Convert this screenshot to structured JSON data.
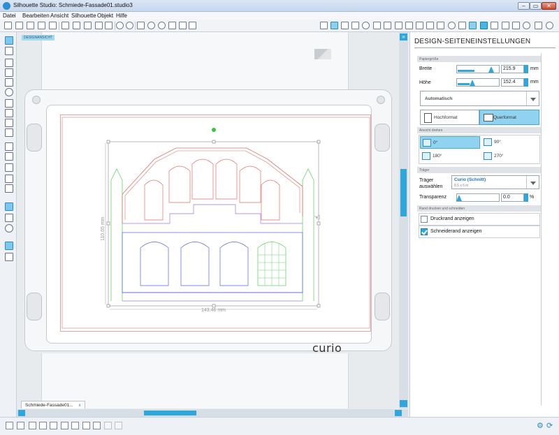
{
  "window": {
    "title": "Silhouette Studio: Schmiede-Fassade01.studio3",
    "min_glyph": "–",
    "max_glyph": "▭",
    "close_glyph": "✕"
  },
  "menu": [
    "Datei",
    "Bearbeiten",
    "Ansicht",
    "Silhouette",
    "Objekt",
    "Hilfe"
  ],
  "canvas": {
    "design_label": "DESIGNANSICHT",
    "tab_label": "Schmiede-Fassade01...",
    "tab_close": "x",
    "brand_logo": "curio",
    "dim_width": "143.46 mm",
    "dim_height": "110.65 mm"
  },
  "panel": {
    "title": "DESIGN-SEITENEINSTELLUNGEN",
    "collapse_glyph": "»",
    "paper_section": "Papiergröße",
    "width_label": "Breite",
    "width_value": "215.9",
    "width_unit": "mm",
    "width_level": 0.42,
    "height_label": "Höhe",
    "height_value": "152.4",
    "height_unit": "mm",
    "height_level": 0.3,
    "size_preset": "Automatisch",
    "portrait_label": "Hochformat",
    "landscape_label": "Querformat",
    "rotate_section": "Ansicht drehen",
    "rotations": [
      "0°",
      "90°",
      "180°",
      "270°"
    ],
    "carrier_section": "Träger",
    "carrier_label": "Träger auswählen",
    "carrier_value": "Curio (Schnitt)",
    "carrier_sub": "8.5 x 6 in",
    "transparency_label": "Transparenz",
    "transparency_value": "0.0",
    "transparency_unit": "%",
    "edge_section": "Rand drucken und schneiden",
    "print_border_label": "Druckrand anzeigen",
    "print_border_checked": false,
    "cut_border_label": "Schneiderand anzeigen",
    "cut_border_checked": true
  },
  "bottom": {
    "gear_glyph": "⚙",
    "refresh_glyph": "⟳"
  },
  "colors": {
    "accent": "#2fa6dc",
    "cut_red": "#e0706a",
    "cut_blue": "#5a62d6",
    "cut_green": "#6ad46a",
    "cut_purple": "#9a7ad8"
  }
}
